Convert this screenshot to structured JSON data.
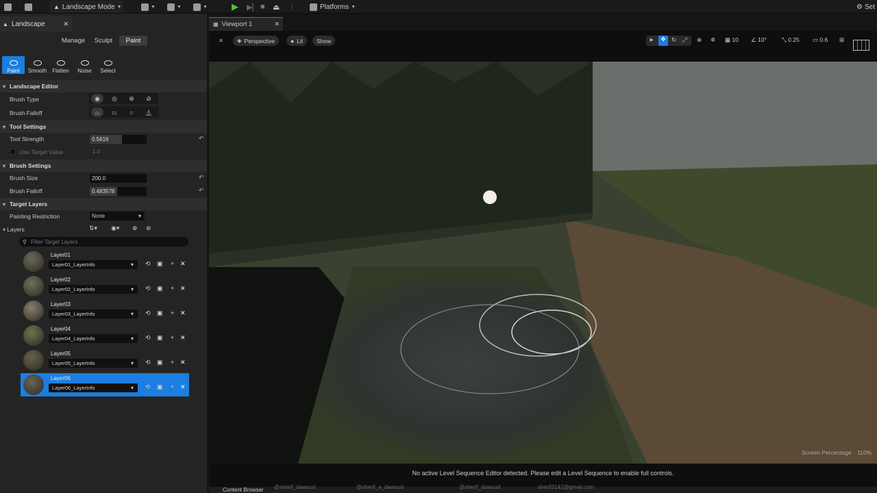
{
  "toolbar": {
    "mode": "Landscape Mode",
    "platforms": "Platforms",
    "settings": "Set"
  },
  "left_panel": {
    "tab": "Landscape",
    "modes": [
      "Manage",
      "Sculpt",
      "Paint"
    ],
    "active_mode": "Paint",
    "tools": [
      "Paint",
      "Smooth",
      "Flatten",
      "Noise",
      "Select"
    ],
    "sections": {
      "editor": "Landscape Editor",
      "tool_settings": "Tool Settings",
      "brush_settings": "Brush Settings",
      "target_layers": "Target Layers",
      "layers": "Layers"
    },
    "brush_type": "Brush Type",
    "brush_falloff_label": "Brush Falloff",
    "tool_strength": {
      "label": "Tool Strength",
      "value": "0.5616",
      "fraction": 0.5616
    },
    "use_target": {
      "label": "Use Target Value",
      "value": "1.0"
    },
    "brush_size": {
      "label": "Brush Size",
      "value": "200.0"
    },
    "brush_falloff": {
      "label": "Brush Falloff",
      "value": "0.483578",
      "fraction": 0.483578
    },
    "painting_restriction": {
      "label": "Painting Restriction",
      "value": "None"
    },
    "filter_placeholder": "Filter Target Layers",
    "layers": [
      {
        "name": "Layer01",
        "info": "Layer01_LayerInfo"
      },
      {
        "name": "Layer02",
        "info": "Layer02_LayerInfo"
      },
      {
        "name": "Layer03",
        "info": "Layer03_LayerInfo"
      },
      {
        "name": "Layer04",
        "info": "Layer04_LayerInfo"
      },
      {
        "name": "Layer05",
        "info": "Layer05_LayerInfo"
      },
      {
        "name": "Layer06",
        "info": "Layer06_LayerInfo"
      }
    ]
  },
  "viewport": {
    "tab": "Viewport 1",
    "perspective": "Perspective",
    "lit": "Lit",
    "show": "Show",
    "grid": "10",
    "angle": "10°",
    "scale": "0.25",
    "camera": "0.6",
    "screen_percentage_label": "Screen Percentage",
    "screen_percentage": "110%",
    "status": "No active Level Sequence Editor detected. Please edit a Level Sequence to enable full controls."
  },
  "bottom": {
    "content_browser": "Content Browser",
    "w1": "@sherif_dawoud",
    "w2": "@sherif_a_dawoud",
    "w3": "@sherif_dawoud",
    "w4": "sherif3142@gmail.com"
  },
  "colors": {
    "accent": "#1b7ee0",
    "play": "#52c43a"
  }
}
